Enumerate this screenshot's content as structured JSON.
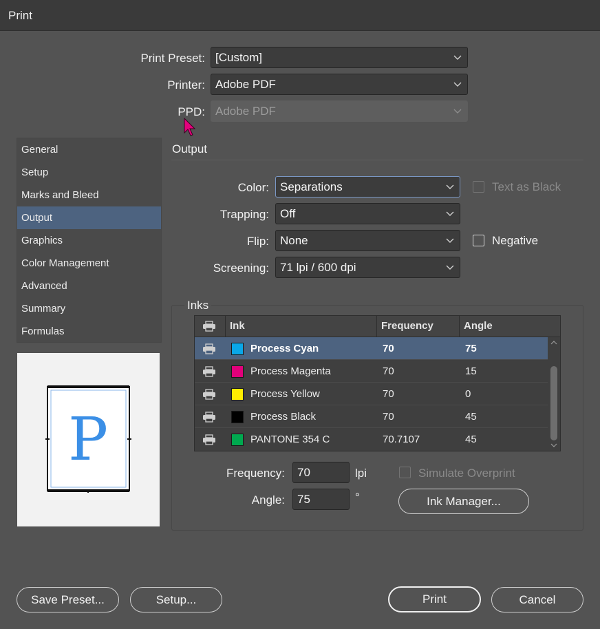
{
  "window": {
    "title": "Print"
  },
  "top_fields": {
    "print_preset": {
      "label": "Print Preset:",
      "value": "[Custom]"
    },
    "printer": {
      "label": "Printer:",
      "value": "Adobe PDF"
    },
    "ppd": {
      "label": "PPD:",
      "value": "Adobe PDF"
    }
  },
  "sidebar": {
    "items": [
      {
        "label": "General"
      },
      {
        "label": "Setup"
      },
      {
        "label": "Marks and Bleed"
      },
      {
        "label": "Output"
      },
      {
        "label": "Graphics"
      },
      {
        "label": "Color Management"
      },
      {
        "label": "Advanced"
      },
      {
        "label": "Summary"
      },
      {
        "label": "Formulas"
      }
    ],
    "active": "Output"
  },
  "preview": {
    "glyph": "P"
  },
  "output": {
    "title": "Output",
    "color": {
      "label": "Color:",
      "value": "Separations"
    },
    "trapping": {
      "label": "Trapping:",
      "value": "Off"
    },
    "flip": {
      "label": "Flip:",
      "value": "None"
    },
    "screening": {
      "label": "Screening:",
      "value": "71 lpi / 600 dpi"
    },
    "text_as_black": {
      "label": "Text as Black",
      "checked": false
    },
    "negative": {
      "label": "Negative",
      "checked": false
    }
  },
  "inks": {
    "title": "Inks",
    "columns": {
      "ink": "Ink",
      "frequency": "Frequency",
      "angle": "Angle"
    },
    "rows": [
      {
        "name": "Process Cyan",
        "frequency": "70",
        "angle": "75",
        "color": "#0aa7e8"
      },
      {
        "name": "Process Magenta",
        "frequency": "70",
        "angle": "15",
        "color": "#e2007a"
      },
      {
        "name": "Process Yellow",
        "frequency": "70",
        "angle": "0",
        "color": "#ffed00"
      },
      {
        "name": "Process Black",
        "frequency": "70",
        "angle": "45",
        "color": "#000000"
      },
      {
        "name": "PANTONE 354 C",
        "frequency": "70.7107",
        "angle": "45",
        "color": "#00a94f"
      }
    ],
    "frequency_field": {
      "label": "Frequency:",
      "value": "70",
      "unit": "lpi"
    },
    "angle_field": {
      "label": "Angle:",
      "value": "75",
      "unit": "°"
    },
    "simulate_overprint": {
      "label": "Simulate Overprint",
      "checked": false
    },
    "ink_manager_label": "Ink Manager..."
  },
  "buttons": {
    "save_preset": "Save Preset...",
    "setup": "Setup...",
    "print": "Print",
    "cancel": "Cancel"
  },
  "colors": {
    "accent": "#4d6380",
    "cursor": "#e4007c"
  }
}
